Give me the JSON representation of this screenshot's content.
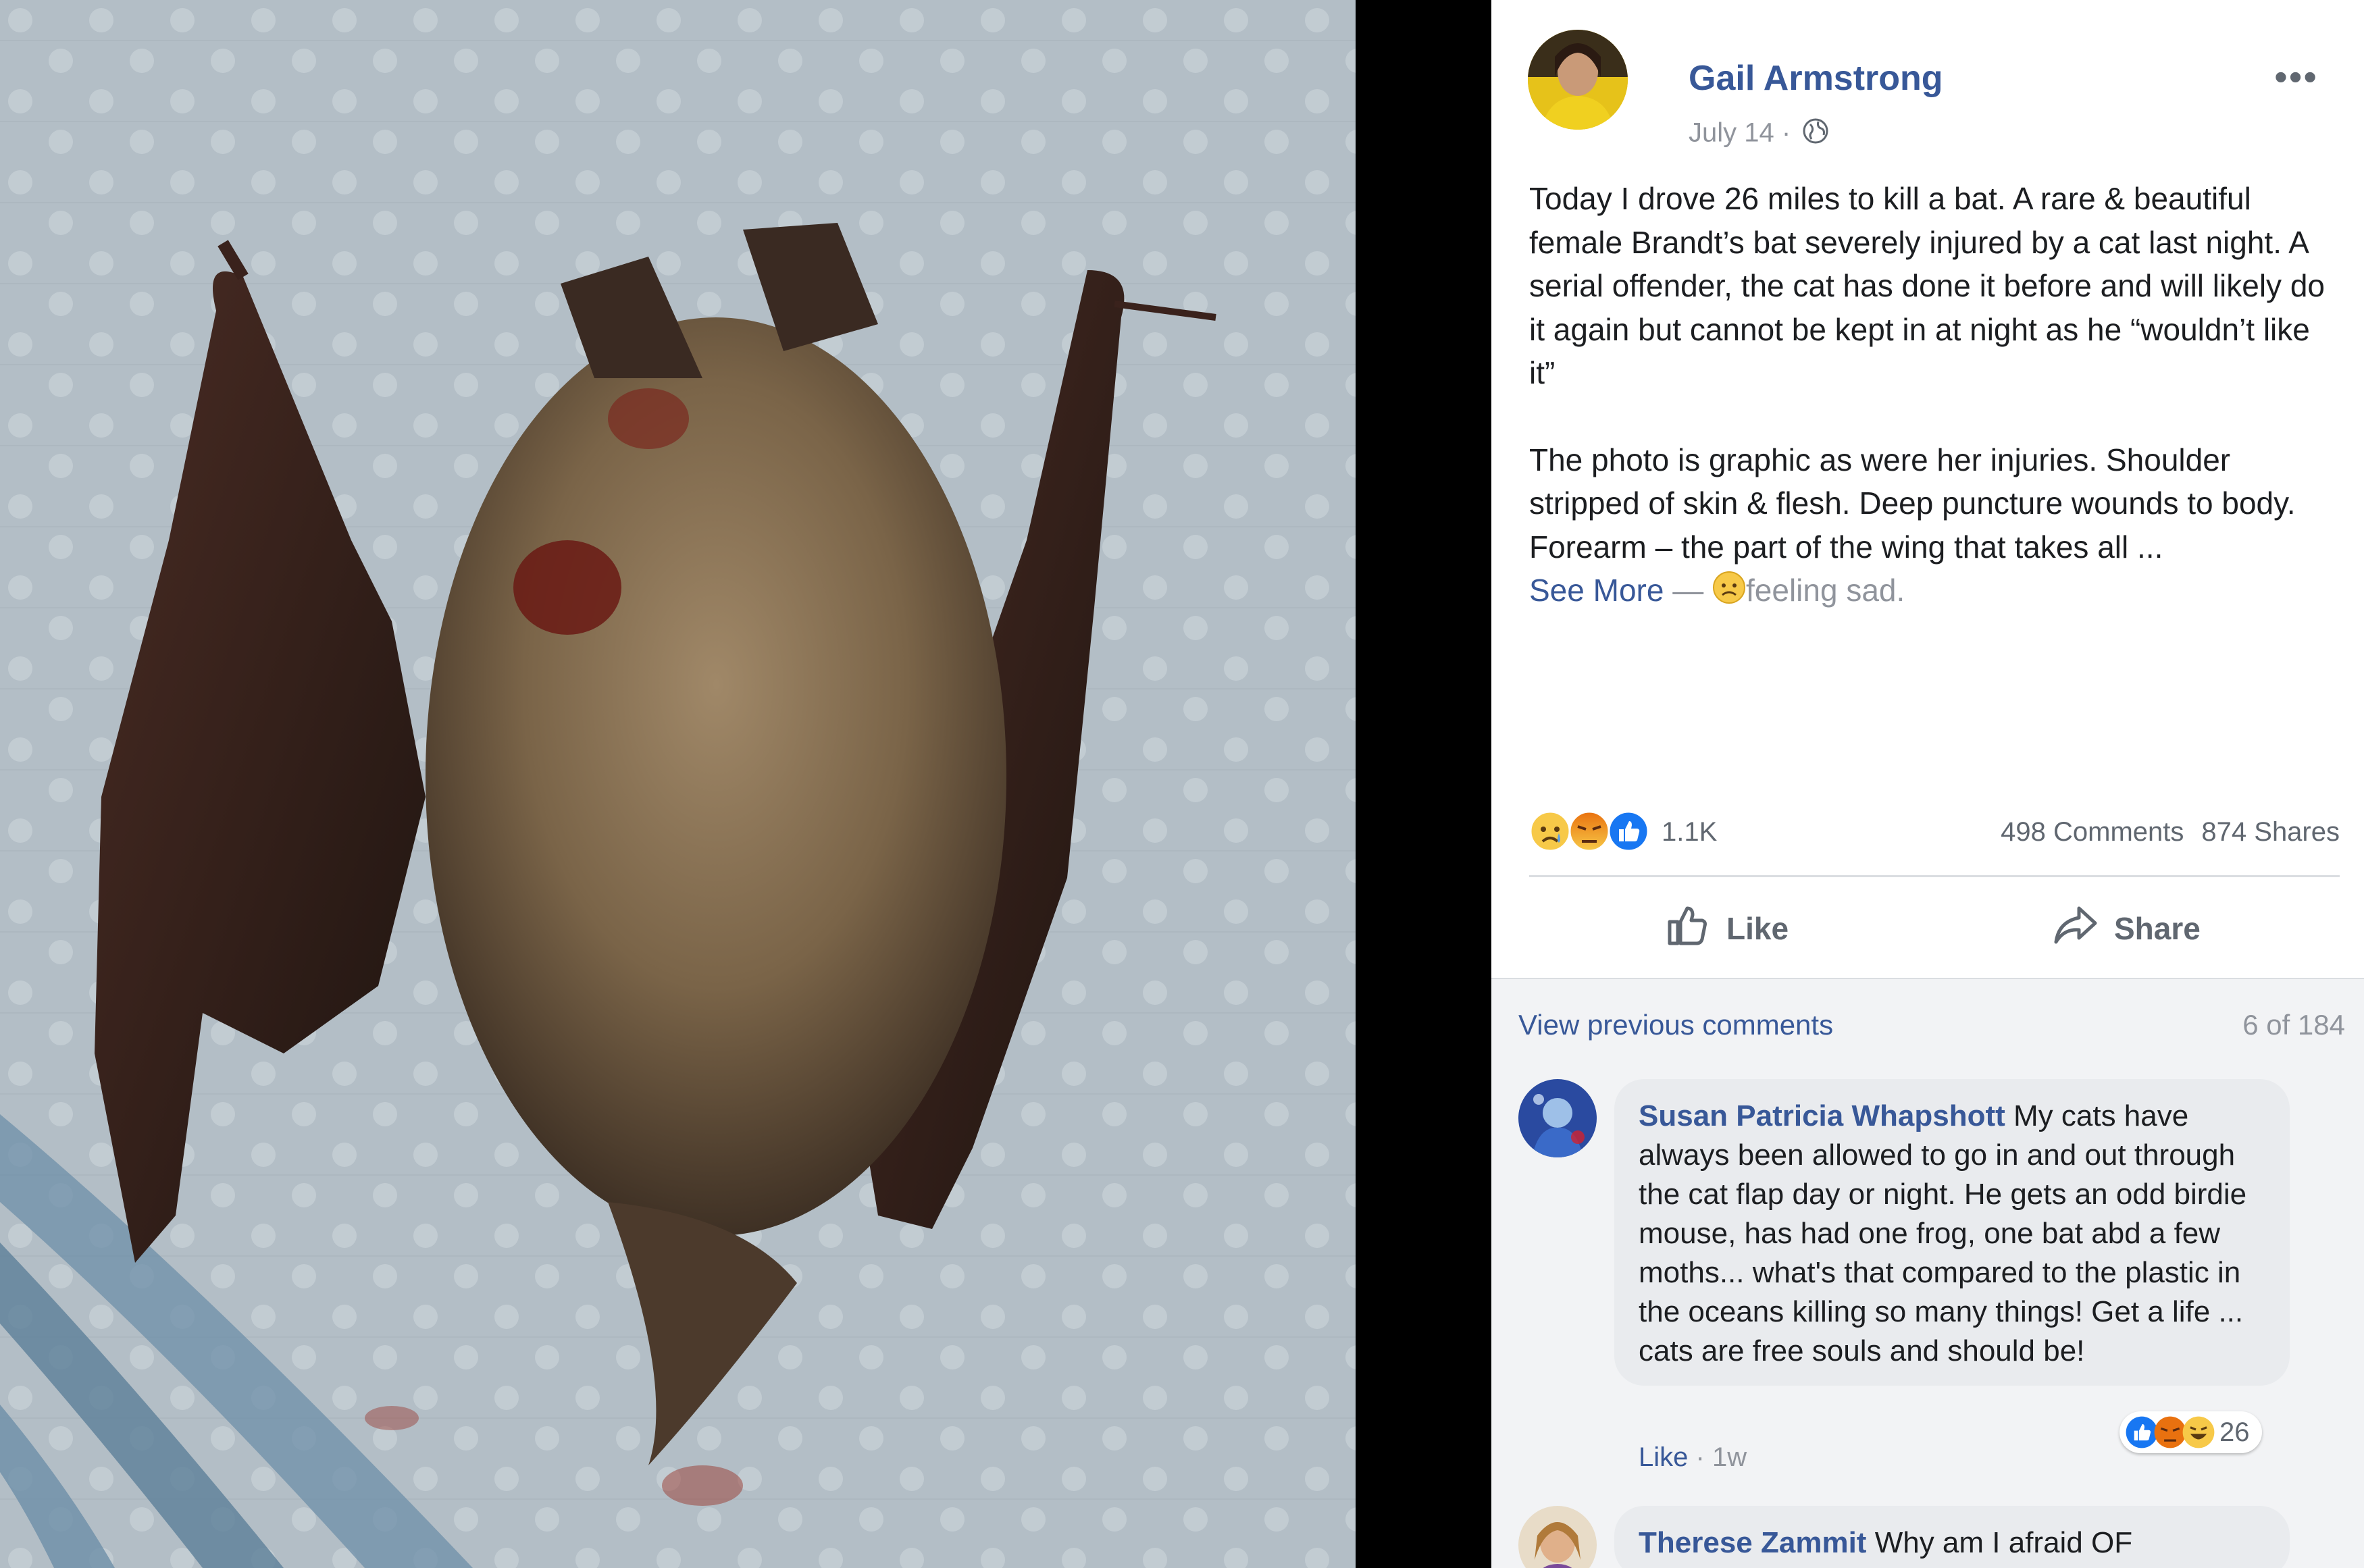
{
  "post": {
    "author": "Gail Armstrong",
    "date": "July 14",
    "separator": "·",
    "more_label": "•••",
    "paragraphs": [
      "Today I drove 26 miles to kill a bat. A rare & beautiful female Brandt’s bat severely injured by a cat last night. A serial offender, the cat has done it before and will likely do it again but cannot be kept in at night as he “wouldn’t like it”",
      "The photo is graphic as were her injuries. Shoulder stripped of skin & flesh. Deep puncture wounds to body. Forearm – the part of the wing that takes all ..."
    ],
    "see_more": "See More",
    "dash": "—",
    "feeling": "feeling sad.",
    "reactions": [
      "sad",
      "angry",
      "like"
    ],
    "reaction_count": "1.1K",
    "comments_count": "498 Comments",
    "shares_count": "874 Shares",
    "actions": {
      "like": "Like",
      "share": "Share"
    }
  },
  "comments_section": {
    "view_previous": "View previous comments",
    "count_of": "6 of 184",
    "comments": [
      {
        "name": "Susan Patricia Whapshott",
        "text": "My cats have always been allowed to go in and out through the cat flap day or night. He gets an odd birdie mouse, has had one frog, one bat abd a few moths... what's that compared to the plastic in the oceans killing so many things! Get a life ... cats are free souls and should be!",
        "like": "Like",
        "sep": "·",
        "time": "1w",
        "reactions": [
          "like",
          "angry",
          "haha"
        ],
        "reaction_count": "26"
      },
      {
        "name": "Therese Zammit",
        "text": "Why am I afraid OF"
      }
    ]
  },
  "colors": {
    "link": "#385898",
    "muted": "#90949c",
    "text": "#1c1e21",
    "like_blue": "#1877f2",
    "angry_red": "#e9710f"
  }
}
